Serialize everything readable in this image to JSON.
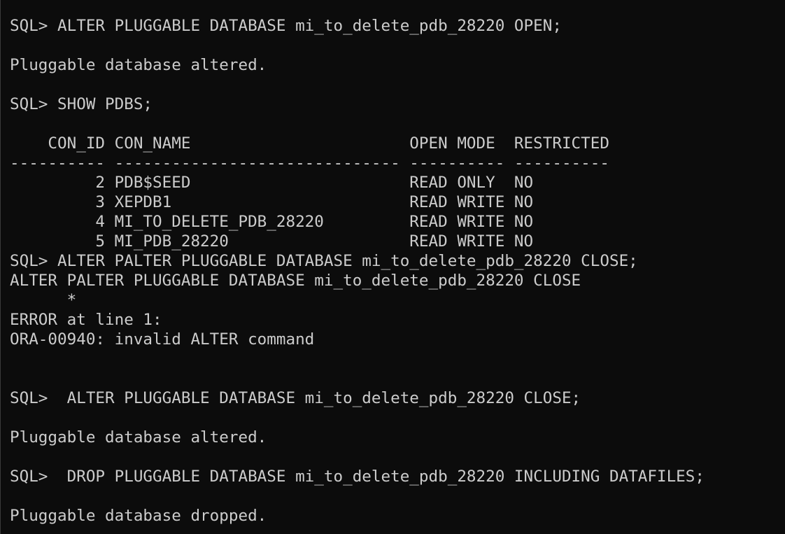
{
  "terminal": {
    "lines": [
      "SQL> ALTER PLUGGABLE DATABASE mi_to_delete_pdb_28220 OPEN;",
      "",
      "Pluggable database altered.",
      "",
      "SQL> SHOW PDBS;",
      "",
      "    CON_ID CON_NAME                       OPEN MODE  RESTRICTED",
      "---------- ------------------------------ ---------- ----------",
      "         2 PDB$SEED                       READ ONLY  NO",
      "         3 XEPDB1                         READ WRITE NO",
      "         4 MI_TO_DELETE_PDB_28220         READ WRITE NO",
      "         5 MI_PDB_28220                   READ WRITE NO",
      "SQL> ALTER PALTER PLUGGABLE DATABASE mi_to_delete_pdb_28220 CLOSE;",
      "ALTER PALTER PLUGGABLE DATABASE mi_to_delete_pdb_28220 CLOSE",
      "      *",
      "ERROR at line 1:",
      "ORA-00940: invalid ALTER command",
      "",
      "",
      "SQL>  ALTER PLUGGABLE DATABASE mi_to_delete_pdb_28220 CLOSE;",
      "",
      "Pluggable database altered.",
      "",
      "SQL>  DROP PLUGGABLE DATABASE mi_to_delete_pdb_28220 INCLUDING DATAFILES;",
      "",
      "Pluggable database dropped."
    ]
  }
}
